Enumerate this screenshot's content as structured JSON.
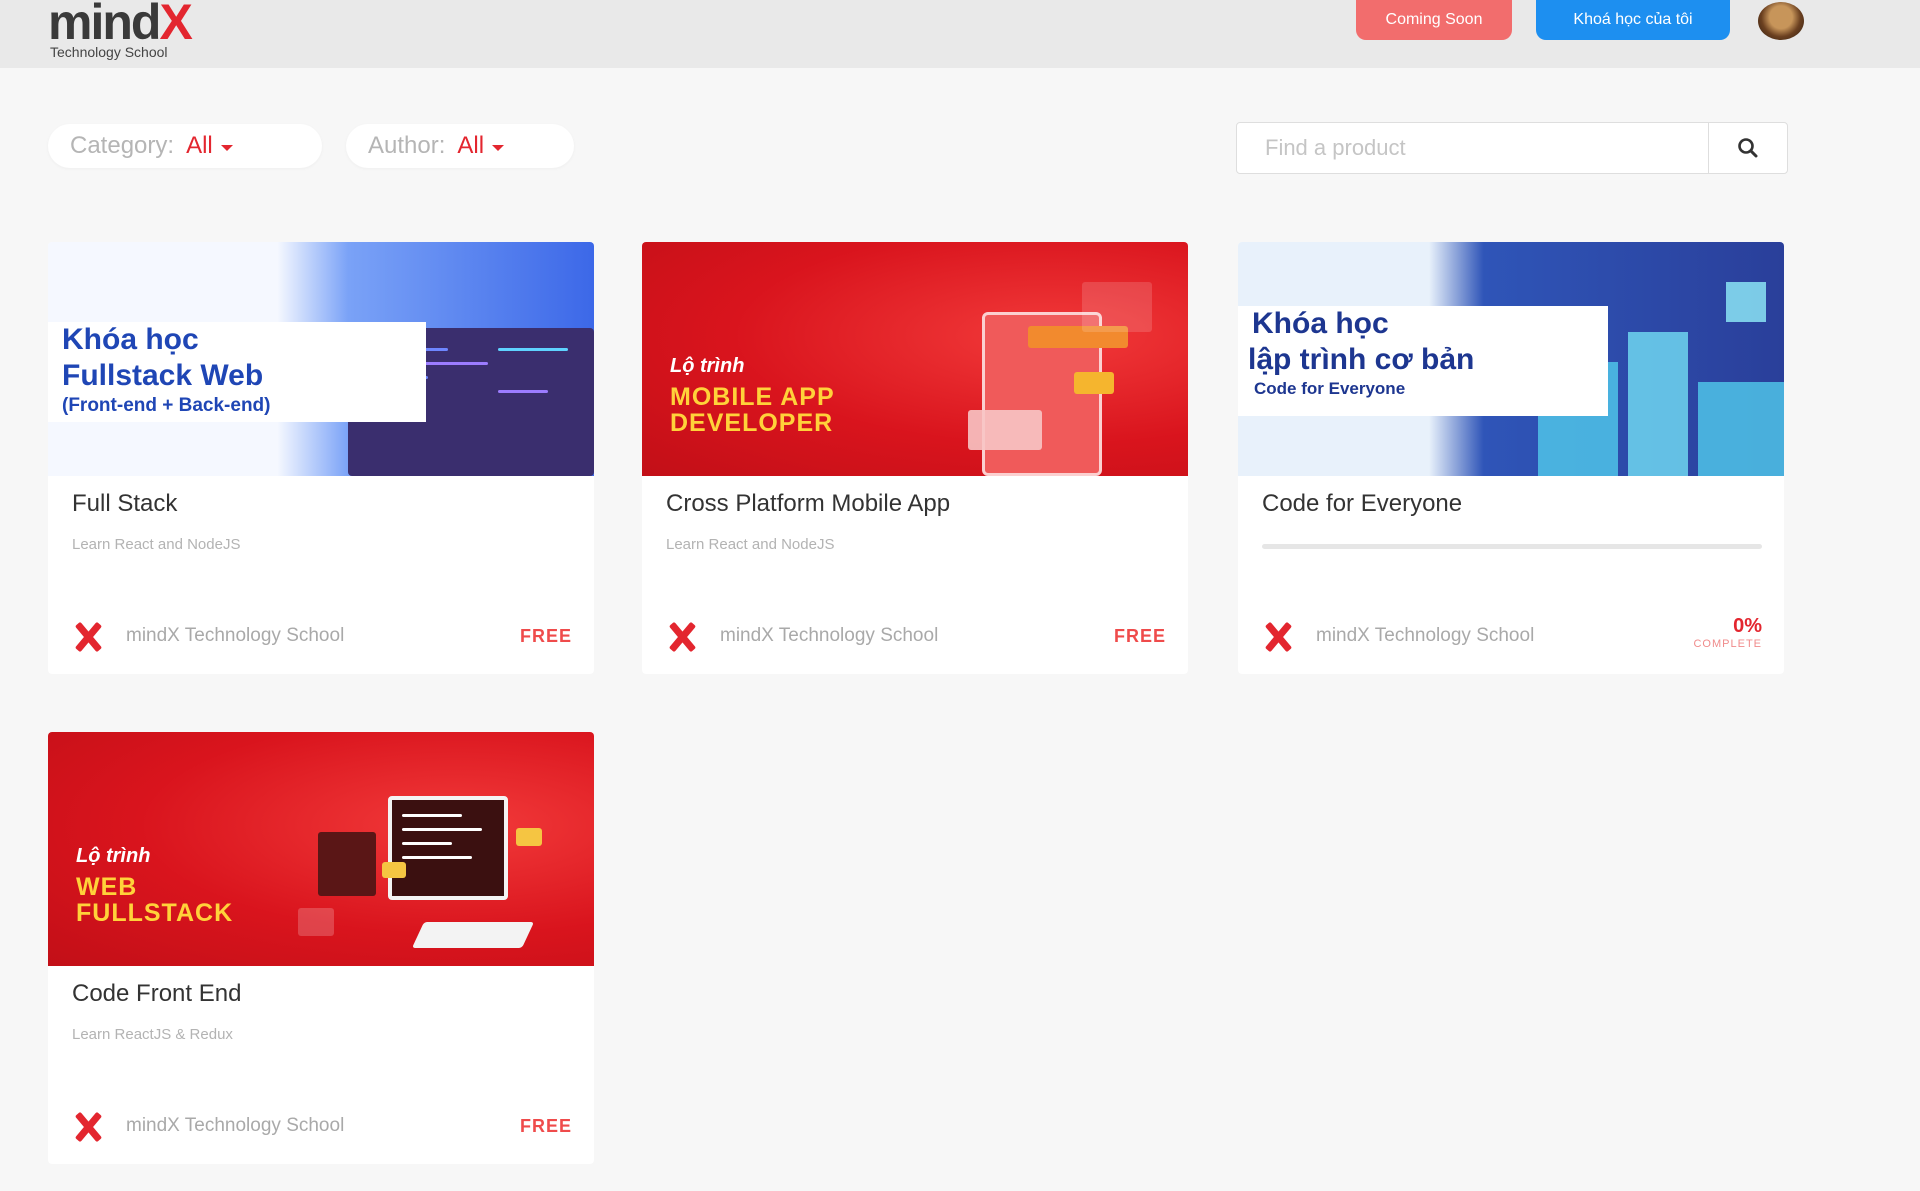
{
  "header": {
    "logo_text": "mind",
    "logo_x": "X",
    "logo_sub": "Technology School",
    "coming_soon_label": "Coming Soon",
    "my_courses_label": "Khoá học của tôi"
  },
  "filters": {
    "category_label": "Category:",
    "category_value": "All",
    "author_label": "Author:",
    "author_value": "All"
  },
  "search": {
    "placeholder": "Find a product"
  },
  "colors": {
    "brand_red": "#e3262f",
    "blue_button": "#1d8ff0",
    "coming_soon": "#f26d6d"
  },
  "courses": [
    {
      "banner": {
        "line1": "Khóa học",
        "line2": "Fullstack Web",
        "line3": "(Front-end + Back-end)"
      },
      "title": "Full Stack",
      "subtitle": "Learn React and NodeJS",
      "author": "mindX Technology School",
      "price": "FREE"
    },
    {
      "banner": {
        "line1": "Lộ trình",
        "line2": "MOBILE APP",
        "line3": "DEVELOPER"
      },
      "title": "Cross Platform Mobile App",
      "subtitle": "Learn React and NodeJS",
      "author": "mindX Technology School",
      "price": "FREE"
    },
    {
      "banner": {
        "line1": "Khóa học",
        "line2": "lập trình cơ bản",
        "line3": "Code for Everyone"
      },
      "title": "Code for Everyone",
      "author": "mindX Technology School",
      "progress": 0,
      "progress_text": "0%",
      "progress_label": "COMPLETE"
    },
    {
      "banner": {
        "line1": "Lộ trình",
        "line2": "WEB",
        "line3": "FULLSTACK"
      },
      "title": "Code Front End",
      "subtitle": "Learn ReactJS & Redux",
      "author": "mindX Technology School",
      "price": "FREE"
    }
  ]
}
